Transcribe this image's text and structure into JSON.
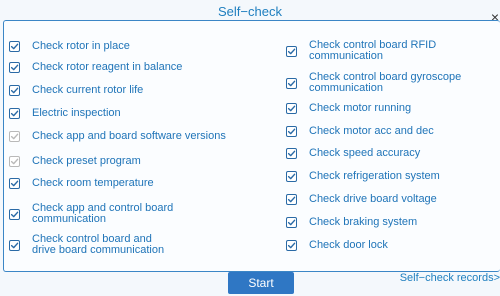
{
  "dialog": {
    "title": "Self−check",
    "close_glyph": "×",
    "start_label": "Start",
    "records_link": "Self−check records>"
  },
  "left_items": [
    {
      "label": "Check rotor in place",
      "checked": true,
      "enabled": true
    },
    {
      "label": "Check rotor reagent in balance",
      "checked": true,
      "enabled": true
    },
    {
      "label": "Check current rotor life",
      "checked": true,
      "enabled": true
    },
    {
      "label": "Electric inspection",
      "checked": true,
      "enabled": true
    },
    {
      "label": "Check app and board software versions",
      "checked": true,
      "enabled": false
    },
    {
      "label": "Check preset program",
      "checked": true,
      "enabled": false
    },
    {
      "label": "Check room temperature",
      "checked": true,
      "enabled": true
    },
    {
      "label": "Check app and control board communication",
      "checked": true,
      "enabled": true
    },
    {
      "label": "Check control board and drive board communication",
      "checked": true,
      "enabled": true
    }
  ],
  "right_items": [
    {
      "label": "Check control board RFID communication",
      "checked": true,
      "enabled": true
    },
    {
      "label": "Check control board gyroscope communication",
      "checked": true,
      "enabled": true
    },
    {
      "label": "Check motor running",
      "checked": true,
      "enabled": true
    },
    {
      "label": "Check motor acc and dec",
      "checked": true,
      "enabled": true
    },
    {
      "label": "Check speed accuracy",
      "checked": true,
      "enabled": true
    },
    {
      "label": "Check refrigeration system",
      "checked": true,
      "enabled": true
    },
    {
      "label": "Check drive board voltage",
      "checked": true,
      "enabled": true
    },
    {
      "label": "Check braking system",
      "checked": true,
      "enabled": true
    },
    {
      "label": "Check door lock",
      "checked": true,
      "enabled": true
    }
  ],
  "colors": {
    "accent": "#1f7fbf",
    "checkbox_border": "#2a6aa6",
    "checkbox_disabled": "#b9b9b9",
    "button_bg": "#2f77c4"
  }
}
